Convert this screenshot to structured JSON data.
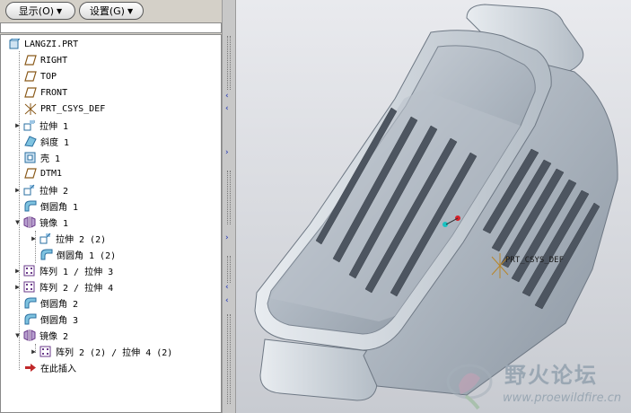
{
  "toolbar": {
    "show_label": "显示(O)",
    "settings_label": "设置(G)"
  },
  "tree": {
    "root": "LANGZI.PRT",
    "items": [
      {
        "label": "RIGHT",
        "icon": "datum-plane-icon"
      },
      {
        "label": "TOP",
        "icon": "datum-plane-icon"
      },
      {
        "label": "FRONT",
        "icon": "datum-plane-icon"
      },
      {
        "label": "PRT_CSYS_DEF",
        "icon": "coordinate-system-icon"
      },
      {
        "label": "拉伸 1",
        "icon": "extrude-icon"
      },
      {
        "label": "斜度 1",
        "icon": "draft-icon"
      },
      {
        "label": "壳 1",
        "icon": "shell-icon"
      },
      {
        "label": "DTM1",
        "icon": "datum-plane-icon"
      },
      {
        "label": "拉伸 2",
        "icon": "extrude-icon"
      },
      {
        "label": "倒圆角 1",
        "icon": "round-icon"
      },
      {
        "label": "镜像 1",
        "icon": "mirror-icon"
      },
      {
        "label": "拉伸 2 (2)",
        "icon": "extrude-icon"
      },
      {
        "label": "倒圆角 1 (2)",
        "icon": "round-icon"
      },
      {
        "label": "阵列 1 / 拉伸 3",
        "icon": "pattern-icon"
      },
      {
        "label": "阵列 2 / 拉伸 4",
        "icon": "pattern-icon"
      },
      {
        "label": "倒圆角 2",
        "icon": "round-icon"
      },
      {
        "label": "倒圆角 3",
        "icon": "round-icon"
      },
      {
        "label": "镜像 2",
        "icon": "mirror-icon"
      },
      {
        "label": "阵列 2 (2) / 拉伸 4 (2)",
        "icon": "pattern-icon"
      },
      {
        "label": "在此插入",
        "icon": "insert-here-arrow-icon"
      }
    ]
  },
  "viewport": {
    "csys_label": "PRT_CSYS_DEF"
  },
  "watermark": {
    "title": "野火论坛",
    "url": "www.proewildfire.cn"
  }
}
